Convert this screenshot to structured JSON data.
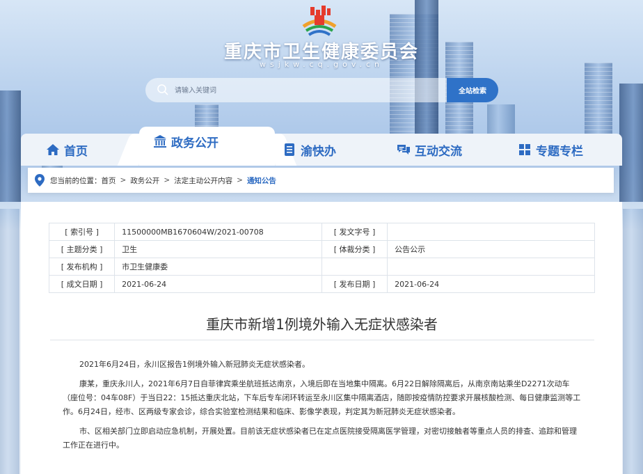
{
  "header": {
    "site_title": "重庆市卫生健康委员会",
    "site_domain": "wsjkw.cq.gov.cn"
  },
  "search": {
    "placeholder": "请输入关键词",
    "button_label": "全站检索"
  },
  "nav": {
    "items": [
      {
        "label": "首页",
        "icon": "home-icon"
      },
      {
        "label": "政务公开",
        "icon": "government-building-icon",
        "active": true
      },
      {
        "label": "渝快办",
        "icon": "document-list-icon"
      },
      {
        "label": "互动交流",
        "icon": "chat-bubbles-icon"
      },
      {
        "label": "专题专栏",
        "icon": "grid-icon"
      }
    ]
  },
  "breadcrumb": {
    "prefix": "您当前的位置：",
    "items": [
      "首页",
      "政务公开",
      "法定主动公开内容",
      "通知公告"
    ],
    "separator": ">"
  },
  "meta": {
    "index_label": "[ 索引号 ]",
    "index_value": "11500000MB1670604W/2021-00708",
    "doc_no_label": "[ 发文字号 ]",
    "doc_no_value": "",
    "topic_label": "[ 主题分类 ]",
    "topic_value": "卫生",
    "genre_label": "[ 体裁分类 ]",
    "genre_value": "公告公示",
    "issuer_label": "[ 发布机构 ]",
    "issuer_value": "市卫生健康委",
    "created_label": "[ 成文日期 ]",
    "created_value": "2021-06-24",
    "published_label": "[ 发布日期 ]",
    "published_value": "2021-06-24"
  },
  "article": {
    "title": "重庆市新增1例境外输入无症状感染者",
    "paragraphs": [
      "2021年6月24日，永川区报告1例境外输入新冠肺炎无症状感染者。",
      "康某，重庆永川人，2021年6月7日自菲律宾乘坐航班抵达南京，入境后即在当地集中隔离。6月22日解除隔离后，从南京南站乘坐D2271次动车（座位号：04车08F）于当日22：15抵达重庆北站，下车后专车闭环转运至永川区集中隔离酒店，随即按疫情防控要求开展核酸检测、每日健康监测等工作。6月24日，经市、区两级专家会诊，综合实验室检测结果和临床、影像学表现，判定其为新冠肺炎无症状感染者。",
      "市、区相关部门立即启动应急机制，开展处置。目前该无症状感染者已在定点医院接受隔离医学管理，对密切接触者等重点人员的排查、追踪和管理工作正在进行中。"
    ]
  },
  "colors": {
    "accent": "#2d6bc2",
    "search_button": "#2f72c8"
  }
}
